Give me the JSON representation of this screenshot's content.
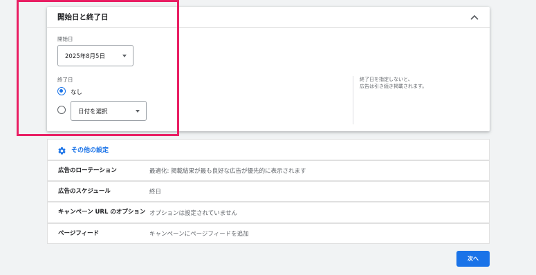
{
  "card": {
    "title": "開始日と終了日",
    "start_label": "開始日",
    "start_value": "2025年8月5日",
    "end_label": "終了日",
    "end_none_label": "なし",
    "end_select_placeholder": "日付を選択",
    "side_note_line1": "終了日を指定しないと、",
    "side_note_line2": "広告は引き続き掲載されます。"
  },
  "settings": {
    "header_label": "その他の設定",
    "rows": [
      {
        "label": "広告のローテーション",
        "value": "最適化: 掲載結果が最も良好な広告が優先的に表示されます"
      },
      {
        "label": "広告のスケジュール",
        "value": "終日"
      },
      {
        "label": "キャンペーン URL のオプション",
        "value": "オプションは設定されていません"
      },
      {
        "label": "ページフィード",
        "value": "キャンペーンにページフィードを追加"
      }
    ]
  },
  "next_label": "次へ",
  "colors": {
    "accent": "#1a73e8",
    "highlight": "#e91e63",
    "background": "#f1f3f4"
  },
  "icons": {
    "collapse": "chevron-up-icon",
    "settings": "gear-icon",
    "dropdown": "caret-down-icon"
  }
}
